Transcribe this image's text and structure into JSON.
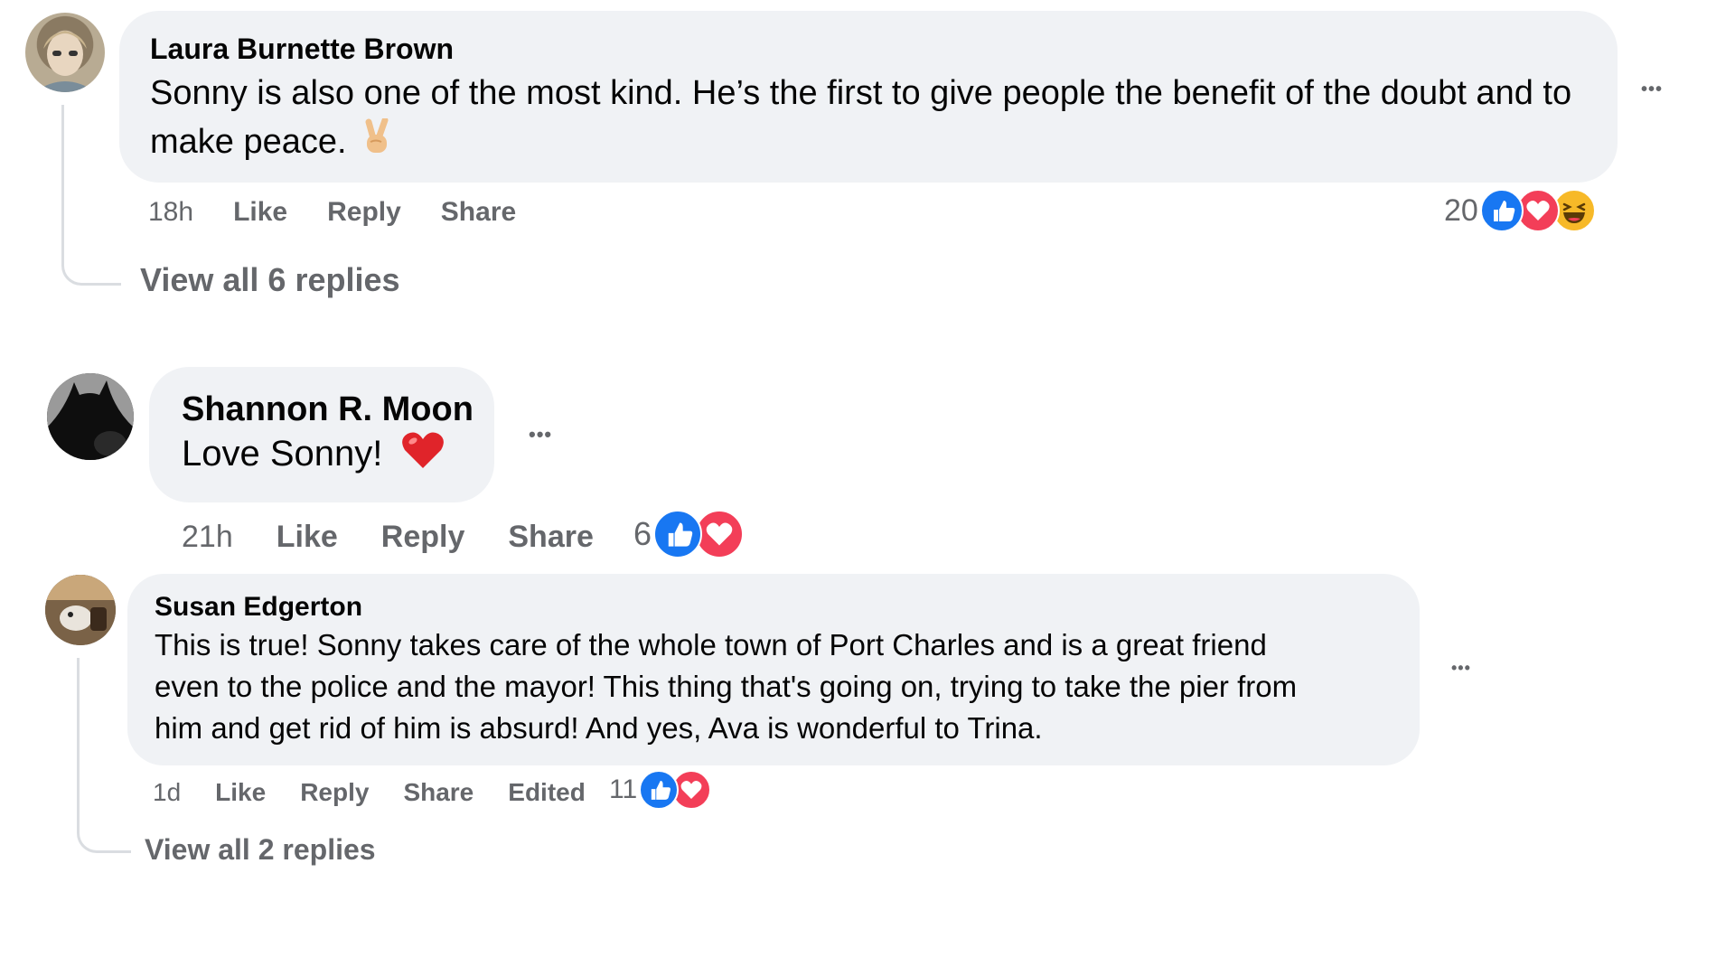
{
  "comments": [
    {
      "author": "Laura Burnette Brown",
      "text": "Sonny is also one of the most kind. He’s the first to give people the benefit of the doubt and to make peace.",
      "emoji": "victory-hand",
      "time": "18h",
      "actions": {
        "like": "Like",
        "reply": "Reply",
        "share": "Share"
      },
      "reaction_count": "20",
      "reaction_types": [
        "like",
        "love",
        "haha"
      ],
      "more_label": "•••",
      "view_replies": "View all 6 replies"
    },
    {
      "author": "Shannon R. Moon",
      "text": "Love Sonny!",
      "emoji": "red-heart",
      "time": "21h",
      "actions": {
        "like": "Like",
        "reply": "Reply",
        "share": "Share"
      },
      "reaction_count": "6",
      "reaction_types": [
        "like",
        "love"
      ],
      "more_label": "•••"
    },
    {
      "author": "Susan Edgerton",
      "text_lines": [
        "This is true! Sonny takes care of the whole town of Port Charles and is a great friend",
        "even to the police and the mayor! This thing that's going on, trying to take the pier from",
        "him and get rid of him is absurd! And yes, Ava is wonderful to Trina."
      ],
      "time": "1d",
      "actions": {
        "like": "Like",
        "reply": "Reply",
        "share": "Share"
      },
      "edited": "Edited",
      "reaction_count": "11",
      "reaction_types": [
        "like",
        "love"
      ],
      "more_label": "•••",
      "view_replies": "View all 2 replies"
    }
  ],
  "colors": {
    "bubble": "#f0f2f5",
    "meta_text": "#65676b",
    "like_blue": "#1877f2",
    "love_red": "#f33e58",
    "haha_yellow": "#f7b928"
  }
}
